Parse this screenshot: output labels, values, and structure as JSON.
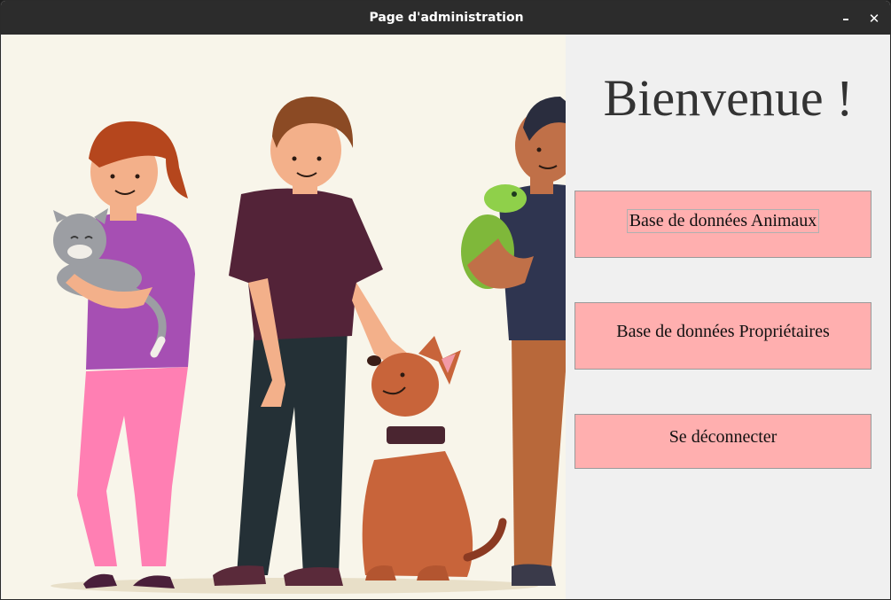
{
  "window": {
    "title": "Page d'administration",
    "minimize_glyph": "–",
    "close_glyph": "✕"
  },
  "main": {
    "welcome": "Bienvenue !",
    "buttons": {
      "animals": "Base de données Animaux",
      "owners": "Base de données Propriétaires",
      "logout": "Se déconnecter"
    }
  },
  "illustration": {
    "description_icon": "people-with-pets-illustration"
  },
  "colors": {
    "titlebar": "#2c2c2c",
    "button_bg": "#ffafaf",
    "panel_bg": "#f0f0f0",
    "illustration_bg": "#f8f5ea"
  }
}
